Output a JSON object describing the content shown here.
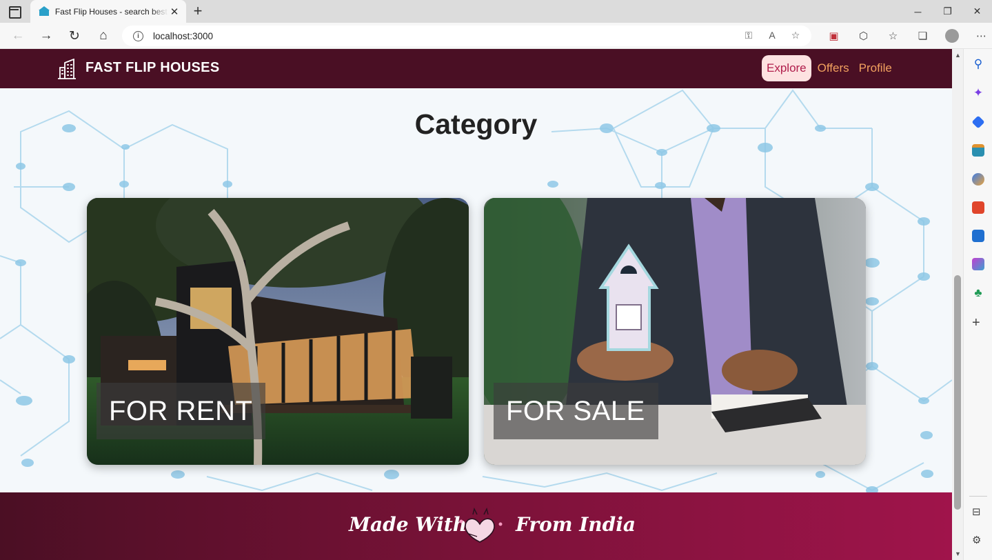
{
  "browser": {
    "tab_title": "Fast Flip Houses - search best houses",
    "url": "localhost:3000",
    "new_tab_symbol": "+",
    "close_symbol": "✕"
  },
  "site": {
    "brand": "FAST FLIP HOUSES",
    "nav": [
      {
        "label": "Explore",
        "active": true
      },
      {
        "label": "Offers",
        "active": false
      },
      {
        "label": "Profile",
        "active": false
      }
    ],
    "section_title": "Category",
    "cards": [
      {
        "label": "FOR RENT"
      },
      {
        "label": "FOR SALE"
      }
    ],
    "footer": {
      "left": "Made With",
      "right": "From India"
    }
  },
  "colors": {
    "header_bg": "#4a0f24",
    "nav_link": "#f2a15f",
    "nav_active_bg": "#fde2e1",
    "nav_active_text": "#b01d4b",
    "footer_start": "#4b0f24",
    "footer_end": "#a0144b"
  },
  "icons": {
    "logo": "building-icon",
    "footer_center": "heart-icon",
    "sidebar": [
      "search-icon",
      "copilot-icon",
      "shopping-tag-icon",
      "tools-icon",
      "games-icon",
      "office-icon",
      "outlook-icon",
      "designer-icon",
      "tree-icon",
      "add-icon",
      "sidebar-toggle-icon",
      "settings-icon"
    ]
  }
}
